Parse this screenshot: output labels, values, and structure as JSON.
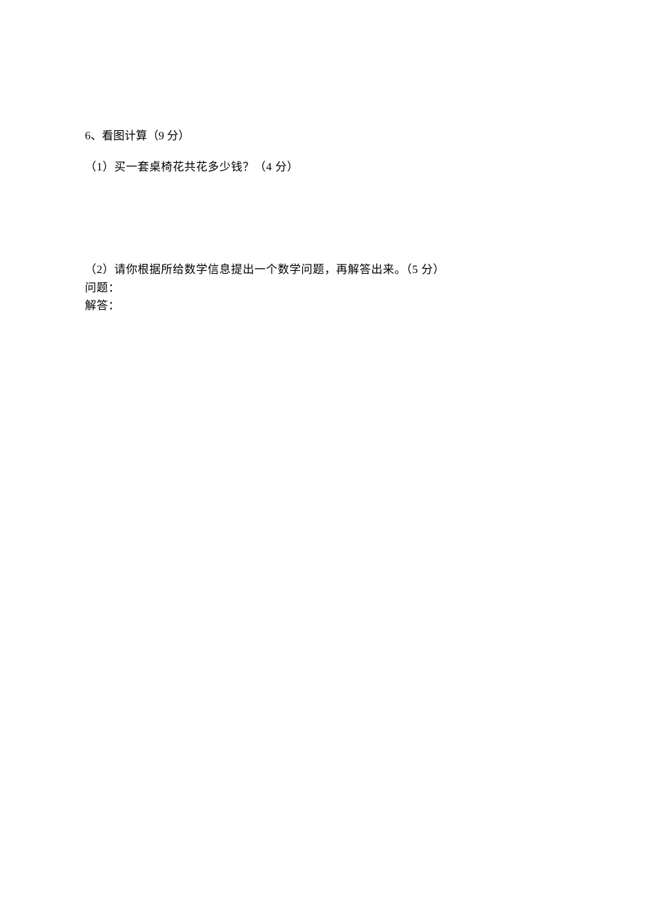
{
  "question": {
    "number": "6",
    "title": "、看图计算（9 分）",
    "part1": {
      "text": "（1）买一套桌椅花共花多少钱？（4 分）"
    },
    "part2": {
      "text": "（2）请你根据所给数学信息提出一个数学问题，再解答出来。（5 分）",
      "question_label": "问题：",
      "answer_label": "解答："
    }
  }
}
